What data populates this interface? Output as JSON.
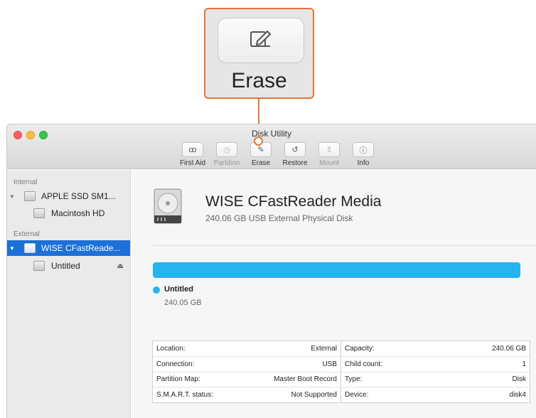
{
  "callout": {
    "label": "Erase"
  },
  "window": {
    "title": "Disk Utility",
    "toolbar": [
      {
        "label": "First Aid",
        "icon": "stethoscope-icon",
        "glyph": "ꝏ",
        "enabled": true
      },
      {
        "label": "Partition",
        "icon": "partition-icon",
        "glyph": "◷",
        "enabled": false
      },
      {
        "label": "Erase",
        "icon": "erase-icon",
        "glyph": "✎",
        "enabled": true
      },
      {
        "label": "Restore",
        "icon": "restore-icon",
        "glyph": "↺",
        "enabled": true
      },
      {
        "label": "Mount",
        "icon": "mount-icon",
        "glyph": "⇕",
        "enabled": false
      },
      {
        "label": "Info",
        "icon": "info-icon",
        "glyph": "ⓘ",
        "enabled": true
      }
    ]
  },
  "sidebar": {
    "internal_label": "Internal",
    "external_label": "External",
    "internal_disk": "APPLE SSD SM1...",
    "internal_volume": "Macintosh HD",
    "external_disk": "WISE CFastReade...",
    "external_volume": "Untitled",
    "eject_glyph": "⏏",
    "disclosure_glyph": "▼"
  },
  "main": {
    "drive_name": "WISE CFastReader Media",
    "drive_desc": "240.06 GB USB External Physical Disk",
    "usage": {
      "volume_name": "Untitled",
      "volume_size": "240.05 GB",
      "color": "#27b4ee",
      "fill_fraction": 1.0
    },
    "info_left": [
      {
        "key": "Location:",
        "value": "External"
      },
      {
        "key": "Connection:",
        "value": "USB"
      },
      {
        "key": "Partition Map:",
        "value": "Master Boot Record"
      },
      {
        "key": "S.M.A.R.T. status:",
        "value": "Not Supported"
      }
    ],
    "info_right": [
      {
        "key": "Capacity:",
        "value": "240.06 GB"
      },
      {
        "key": "Child count:",
        "value": "1"
      },
      {
        "key": "Type:",
        "value": "Disk"
      },
      {
        "key": "Device:",
        "value": "disk4"
      }
    ]
  },
  "colors": {
    "accent": "#e0763a",
    "selection": "#1c70d8",
    "usage": "#27b4ee"
  }
}
